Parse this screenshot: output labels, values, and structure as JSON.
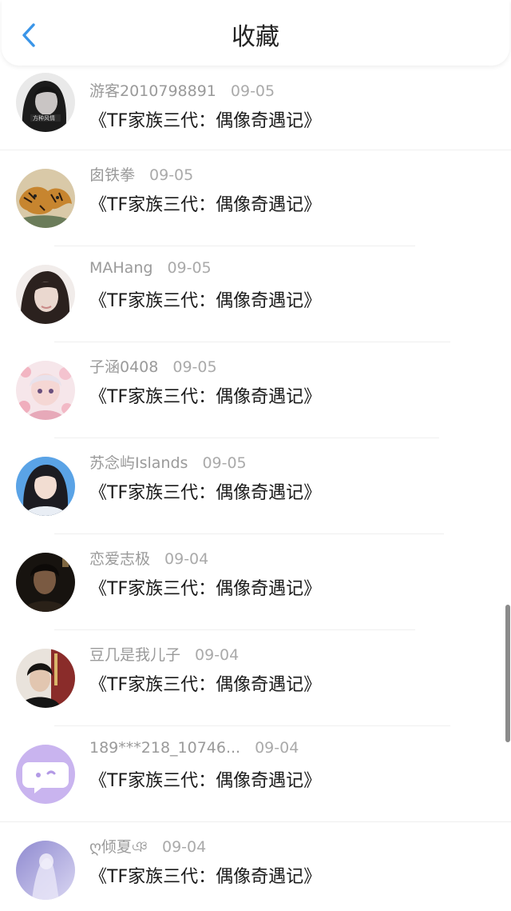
{
  "header": {
    "title": "收藏"
  },
  "items": [
    {
      "user": "游客2010798891",
      "time": "09-05",
      "message": "《TF家族三代：偶像奇遇记》",
      "avatar": "avatar-dark-girl"
    },
    {
      "user": "囱铁拳",
      "time": "09-05",
      "message": "《TF家族三代：偶像奇遇记》",
      "avatar": "avatar-tigers"
    },
    {
      "user": "MAHang",
      "time": "09-05",
      "message": "《TF家族三代：偶像奇遇记》",
      "avatar": "avatar-girl-portrait"
    },
    {
      "user": "子涵0408",
      "time": "09-05",
      "message": "《TF家族三代：偶像奇遇记》",
      "avatar": "avatar-anime-pink"
    },
    {
      "user": "苏念屿Islands",
      "time": "09-05",
      "message": "《TF家族三代：偶像奇遇记》",
      "avatar": "avatar-girl-blue"
    },
    {
      "user": "恋爱志极",
      "time": "09-04",
      "message": "《TF家族三代：偶像奇遇记》",
      "avatar": "avatar-boy-dark"
    },
    {
      "user": "豆几是我儿子",
      "time": "09-04",
      "message": "《TF家族三代：偶像奇遇记》",
      "avatar": "avatar-boy-room"
    },
    {
      "user": "189***218_10746...",
      "time": "09-04",
      "message": "《TF家族三代：偶像奇遇记》",
      "avatar": "avatar-chat-bubble-default"
    },
    {
      "user": "ღ倾夏ঞ",
      "time": "09-04",
      "message": "《TF家族三代：偶像奇遇记》",
      "avatar": "avatar-blurred-purple"
    }
  ],
  "colors": {
    "accent": "#3a95e8",
    "title": "#222222",
    "meta": "#9a9a9a",
    "message": "#1a1a1a",
    "divider": "#efefef"
  }
}
